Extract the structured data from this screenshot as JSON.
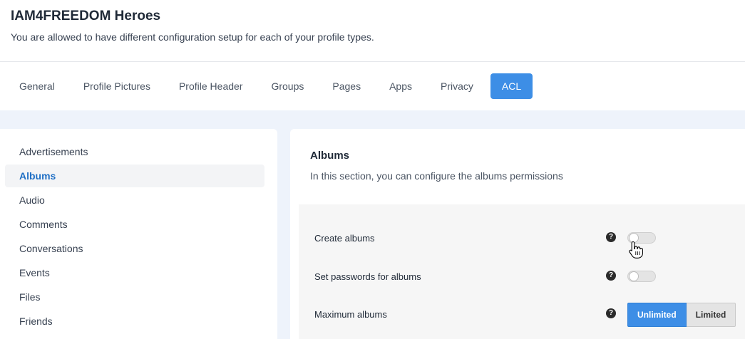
{
  "header": {
    "title": "IAM4FREEDOM Heroes",
    "subtitle": "You are allowed to have different configuration setup for each of your profile types."
  },
  "tabs": [
    {
      "label": "General"
    },
    {
      "label": "Profile Pictures"
    },
    {
      "label": "Profile Header"
    },
    {
      "label": "Groups"
    },
    {
      "label": "Pages"
    },
    {
      "label": "Apps"
    },
    {
      "label": "Privacy"
    },
    {
      "label": "ACL",
      "active": true
    }
  ],
  "sidebar": {
    "items": [
      {
        "label": "Advertisements"
      },
      {
        "label": "Albums",
        "active": true
      },
      {
        "label": "Audio"
      },
      {
        "label": "Comments"
      },
      {
        "label": "Conversations"
      },
      {
        "label": "Events"
      },
      {
        "label": "Files"
      },
      {
        "label": "Friends"
      }
    ]
  },
  "main": {
    "title": "Albums",
    "description": "In this section, you can configure the albums permissions",
    "help_glyph": "?",
    "settings": {
      "create_albums": {
        "label": "Create albums",
        "enabled": false
      },
      "set_passwords": {
        "label": "Set passwords for albums",
        "enabled": false
      },
      "max_albums": {
        "label": "Maximum albums",
        "options": [
          "Unlimited",
          "Limited"
        ],
        "selected": "Unlimited"
      }
    }
  },
  "colors": {
    "accent": "#3d8ee6",
    "active_link": "#1f6fc5",
    "page_bg": "#eef3fb"
  }
}
